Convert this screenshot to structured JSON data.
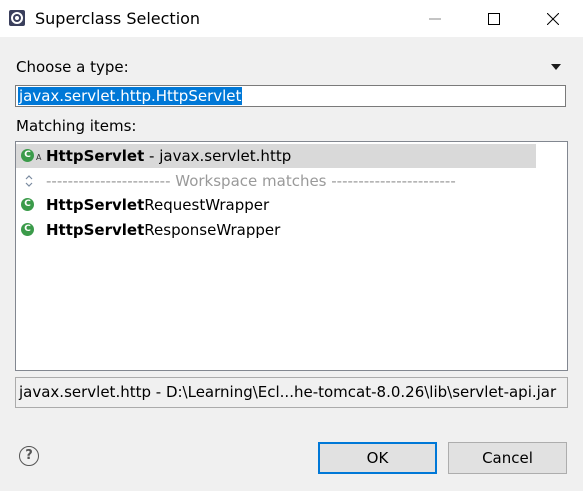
{
  "window": {
    "title": "Superclass Selection",
    "icon": "eclipse-gear-icon"
  },
  "controls": {
    "minimize": "minimize-icon",
    "maximize": "maximize-icon",
    "close": "close-icon"
  },
  "form": {
    "choose_label": "Choose a type:",
    "type_value": "javax.servlet.http.HttpServlet",
    "matching_label": "Matching items:"
  },
  "items": [
    {
      "bold": "HttpServlet",
      "rest": " - javax.servlet.http",
      "icon": "class-icon",
      "selected": true
    },
    {
      "separator": "----------------------- Workspace matches -----------------------",
      "icon": "expand-collapse-icon"
    },
    {
      "bold": "HttpServlet",
      "rest": "RequestWrapper",
      "icon": "class-icon"
    },
    {
      "bold": "HttpServlet",
      "rest": "ResponseWrapper",
      "icon": "class-icon"
    }
  ],
  "status": "javax.servlet.http - D:\\Learning\\Ecl...he-tomcat-8.0.26\\lib\\servlet-api.jar",
  "buttons": {
    "ok": "OK",
    "cancel": "Cancel"
  },
  "colors": {
    "selection": "#0078d7",
    "class_icon": "#3b9b4a",
    "default_button_border": "#0078d7"
  }
}
